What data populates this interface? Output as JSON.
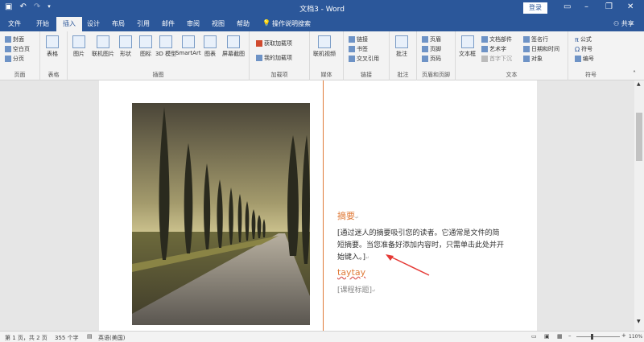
{
  "window": {
    "title": "文档3 - Word",
    "login_label": "登录",
    "share_label": "共享"
  },
  "tabs": [
    "文件",
    "开始",
    "插入",
    "设计",
    "布局",
    "引用",
    "邮件",
    "审阅",
    "视图",
    "帮助",
    "操作说明搜索"
  ],
  "ribbon": {
    "pages_group": {
      "label": "页面",
      "items": [
        "封面",
        "空白页",
        "分页"
      ]
    },
    "tables_group": {
      "label": "表格",
      "items": [
        "表格"
      ]
    },
    "illustrations_group": {
      "label": "插图",
      "items": [
        "图片",
        "联机图片",
        "形状",
        "图标",
        "3D 模型",
        "SmartArt",
        "图表",
        "屏幕截图"
      ]
    },
    "addins_group": {
      "label": "加载项",
      "items": [
        "获取加载项",
        "我的加载项"
      ]
    },
    "media_group": {
      "label": "媒体",
      "items": [
        "联机视频"
      ]
    },
    "links_group": {
      "label": "链接",
      "items": [
        "链接",
        "书签",
        "交叉引用"
      ]
    },
    "comments_group": {
      "label": "批注",
      "items": [
        "批注"
      ]
    },
    "header_footer_group": {
      "label": "页眉和页脚",
      "items": [
        "页眉",
        "页脚",
        "页码"
      ]
    },
    "text_group": {
      "label": "文本",
      "items": [
        "文本框",
        "文档部件",
        "艺术字",
        "首字下沉",
        "签名行",
        "日期和时间",
        "对象"
      ]
    },
    "symbols_group": {
      "label": "符号",
      "items": [
        "公式",
        "符号",
        "编号"
      ]
    }
  },
  "document": {
    "abstract_heading": "摘要",
    "abstract_body": [
      "[通过迷人的摘要吸引您的读者。它通常是文件的简",
      "短摘要。当您准备好添加内容时，只需单击此处并开",
      "始键入。]"
    ],
    "author": "taytay",
    "course_title": "[课程标题]"
  },
  "statusbar": {
    "page": "第 1 页，共 2 页",
    "words": "355 个字",
    "language": "英语(美国)",
    "zoom": "110%"
  },
  "colors": {
    "accent": "#2b579a",
    "orange": "#e07b39"
  }
}
